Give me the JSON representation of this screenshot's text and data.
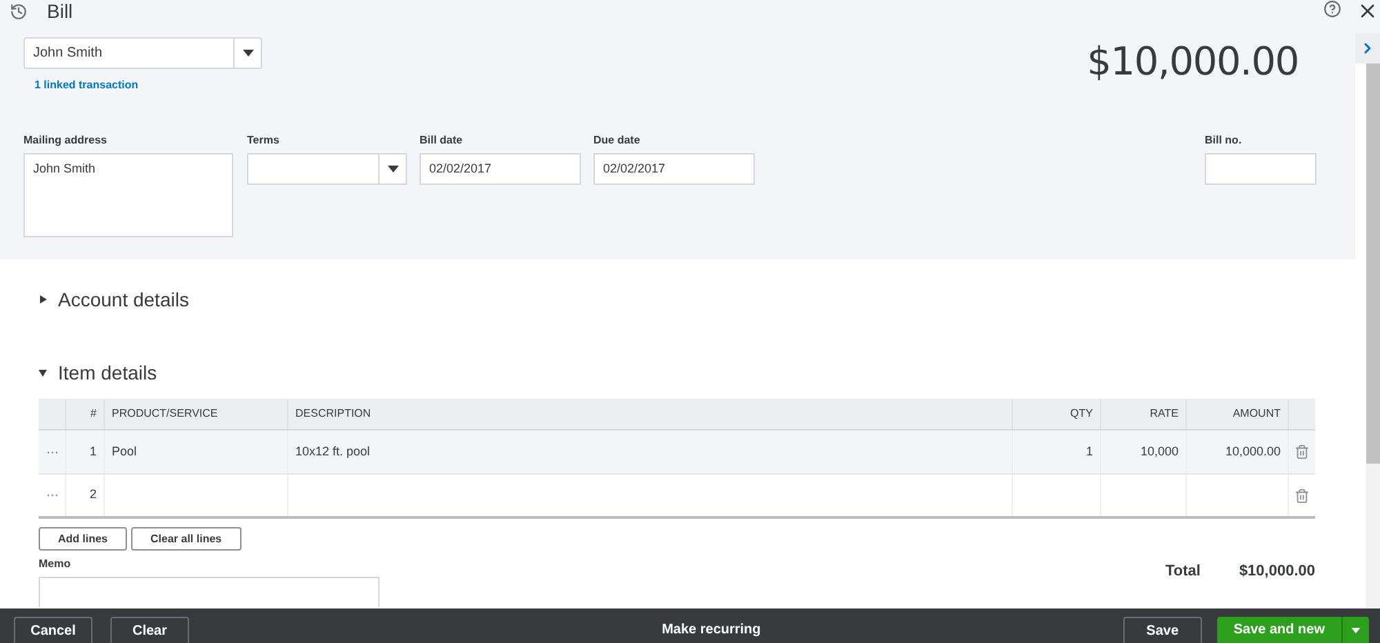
{
  "window": {
    "title": "Bill"
  },
  "vendor": {
    "value": "John Smith",
    "link": "1 linked transaction"
  },
  "balance": {
    "amount": "$10,000.00"
  },
  "fields": [
    {
      "label": "Mailing address",
      "value": "John Smith",
      "kind": "textarea"
    },
    {
      "label": "Terms",
      "kind": "select"
    },
    {
      "label": "Bill date",
      "value": "02/02/2017",
      "kind": "text"
    },
    {
      "label": "Due date",
      "value": "02/02/2017",
      "kind": "text"
    }
  ],
  "bill_no": {
    "label": "Bill no."
  },
  "sections": [
    {
      "title": "Account details",
      "expanded": false
    },
    {
      "title": "Item details",
      "expanded": true
    }
  ],
  "table": {
    "columns": [
      "#",
      "PRODUCT/SERVICE",
      "DESCRIPTION",
      "QTY",
      "RATE",
      "AMOUNT"
    ],
    "rows": [
      {
        "cells": [
          "1",
          "Pool",
          "10x12 ft. pool",
          "1",
          "10,000",
          "10,000.00"
        ],
        "selected": true
      },
      {
        "cells": [
          "2",
          "",
          "",
          "",
          "",
          ""
        ],
        "selected": false
      }
    ]
  },
  "table_buttons": [
    "Add lines",
    "Clear all lines"
  ],
  "memo": {
    "label": "Memo"
  },
  "total": {
    "label": "Total",
    "value": "$10,000.00"
  },
  "footer": {
    "left": [
      "Cancel",
      "Clear"
    ],
    "center": "Make recurring",
    "save": "Save",
    "primary": "Save and new"
  }
}
